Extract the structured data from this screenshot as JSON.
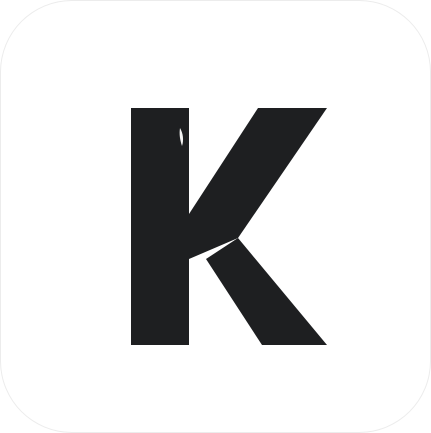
{
  "icon": {
    "name": "k-letter-icon",
    "letter": "K",
    "colors": {
      "background": "#ffffff",
      "glyph": "#1e1f21",
      "highlight": "#f4f4f4"
    }
  }
}
